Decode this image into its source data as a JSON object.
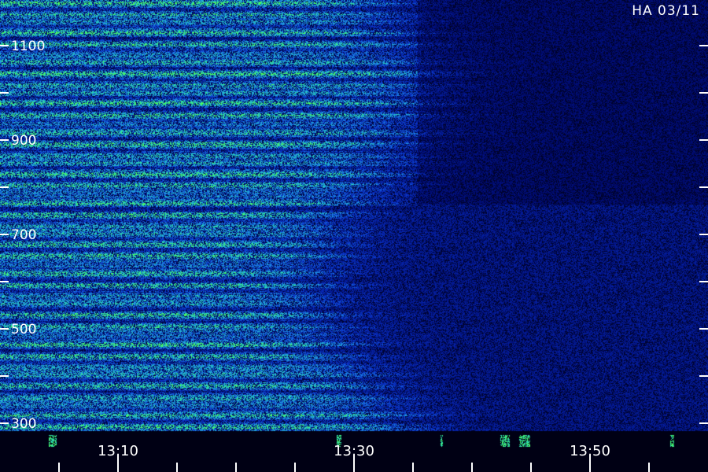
{
  "station_label": "HA 03/11",
  "chart_data": {
    "type": "heatmap",
    "title": "",
    "xlabel": "",
    "ylabel": "",
    "x_tick_labels": [
      "13:10",
      "13:30",
      "13:50"
    ],
    "y_tick_labels": [
      "1100",
      "900",
      "700",
      "500",
      "300"
    ],
    "y_unit_guess": "frequency",
    "colormap": [
      "#000014",
      "#000a6e",
      "#0a32c8",
      "#1e90e6",
      "#28dcb4",
      "#50ff50"
    ],
    "description_values": {
      "intense_band_time_range": [
        "13:00",
        "13:33"
      ],
      "background_after": "13:33"
    }
  }
}
